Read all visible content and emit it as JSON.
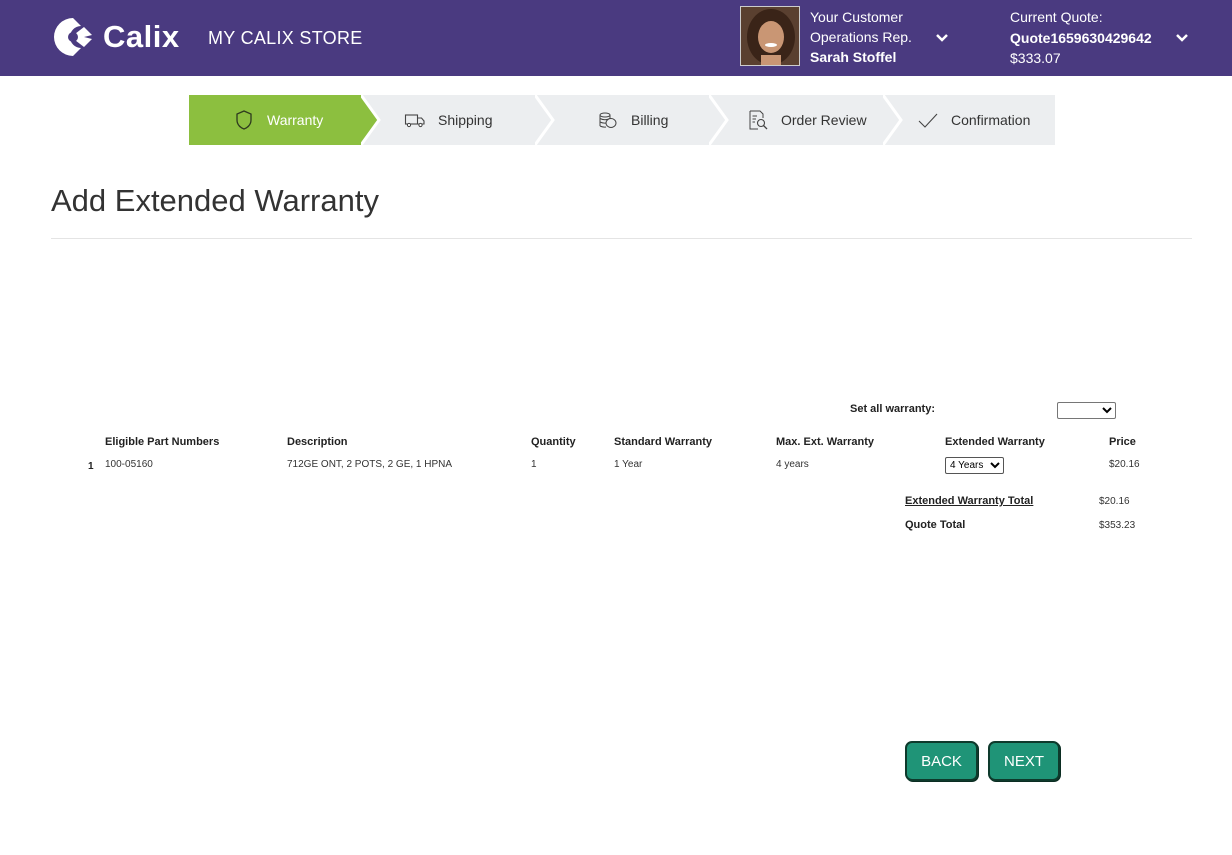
{
  "header": {
    "brand": "Calix",
    "store_title": "MY CALIX STORE",
    "rep_line1": "Your Customer",
    "rep_line2": "Operations Rep.",
    "rep_name": "Sarah Stoffel",
    "quote_label": "Current Quote:",
    "quote_id": "Quote1659630429642",
    "quote_amount": "$333.07"
  },
  "stepper": {
    "steps": [
      {
        "label": "Warranty",
        "icon": "shield-icon",
        "active": true
      },
      {
        "label": "Shipping",
        "icon": "truck-icon",
        "active": false
      },
      {
        "label": "Billing",
        "icon": "coins-icon",
        "active": false
      },
      {
        "label": "Order Review",
        "icon": "document-search-icon",
        "active": false
      },
      {
        "label": "Confirmation",
        "icon": "checkmark-icon",
        "active": false
      }
    ]
  },
  "page": {
    "title": "Add Extended Warranty"
  },
  "warranty": {
    "set_all_label": "Set all warranty:",
    "set_all_value": "",
    "columns": [
      "Eligible Part Numbers",
      "Description",
      "Quantity",
      "Standard Warranty",
      "Max. Ext. Warranty",
      "Extended Warranty",
      "Price"
    ],
    "rows": [
      {
        "index": "1",
        "part": "100-05160",
        "description": "712GE ONT, 2 POTS, 2 GE, 1 HPNA",
        "quantity": "1",
        "standard": "1 Year",
        "max_ext": "4 years",
        "extended": "4 Years",
        "price": "$20.16"
      }
    ],
    "ext_total_label": "Extended Warranty Total",
    "ext_total_value": "$20.16",
    "quote_total_label": "Quote Total",
    "quote_total_value": "$353.23"
  },
  "buttons": {
    "back": "BACK",
    "next": "NEXT"
  },
  "colors": {
    "header": "#4a3a80",
    "active_step": "#8cbf3f",
    "inactive_step": "#eceef0",
    "button": "#1f9477"
  }
}
